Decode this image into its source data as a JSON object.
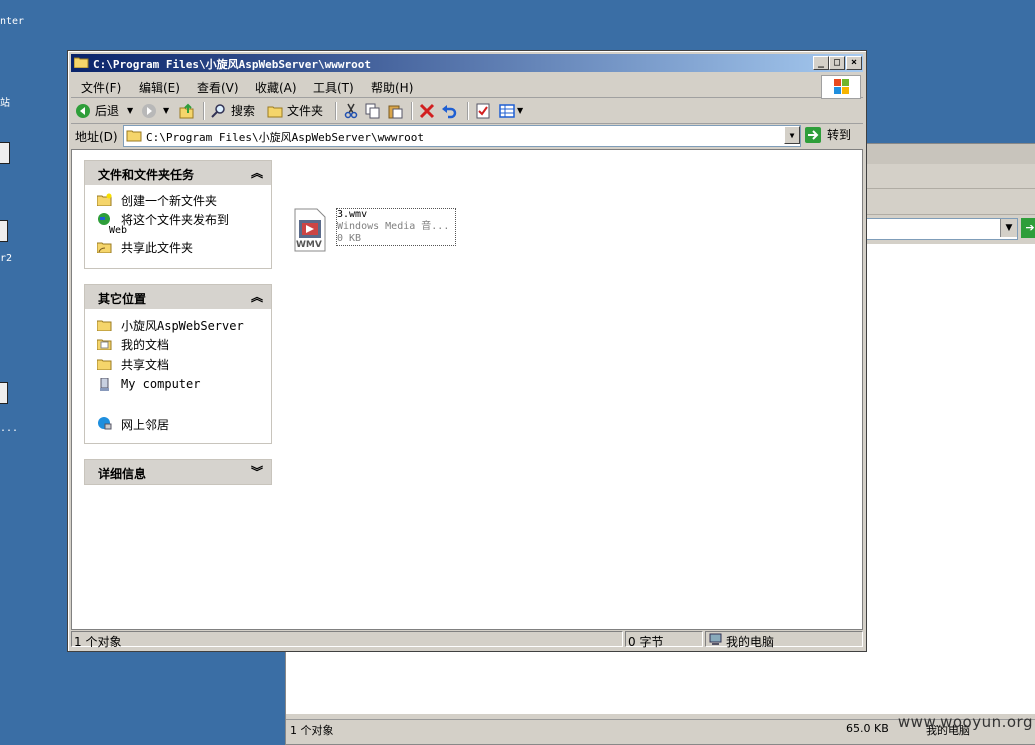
{
  "desktop": {
    "labels": [
      "nter",
      "站",
      "r2",
      "..."
    ]
  },
  "background_window": {
    "status_left": "1 个对象",
    "status_size": "65.0 KB",
    "status_loc": "我的电脑"
  },
  "watermark": "www.wooyun.org",
  "window": {
    "title": "C:\\Program Files\\小旋风AspWebServer\\wwwroot",
    "buttons": {
      "minimize": "_",
      "maximize": "□",
      "close": "×"
    },
    "menus": [
      "文件(F)",
      "编辑(E)",
      "查看(V)",
      "收藏(A)",
      "工具(T)",
      "帮助(H)"
    ],
    "toolbar": {
      "back": "后退",
      "search": "搜索",
      "folders": "文件夹"
    },
    "address": {
      "label": "地址(D)",
      "value": "C:\\Program Files\\小旋风AspWebServer\\wwwroot",
      "go": "转到"
    },
    "tasks": {
      "title": "文件和文件夹任务",
      "items": [
        "创建一个新文件夹",
        "将这个文件夹发布到",
        "Web",
        "共享此文件夹"
      ]
    },
    "places": {
      "title": "其它位置",
      "items": [
        "小旋风AspWebServer",
        "我的文档",
        "共享文档",
        "My computer",
        "网上邻居"
      ]
    },
    "details": {
      "title": "详细信息"
    },
    "file": {
      "name": "3.wmv",
      "type": "Windows Media 音...",
      "size": "0 KB",
      "icon_label": "WMV"
    },
    "status": {
      "count": "1 个对象",
      "bytes": "0 字节",
      "location": "我的电脑"
    }
  },
  "colors": {
    "desktop": "#3a6ea5",
    "title_start": "#0a246a",
    "title_end": "#a6caf0"
  }
}
